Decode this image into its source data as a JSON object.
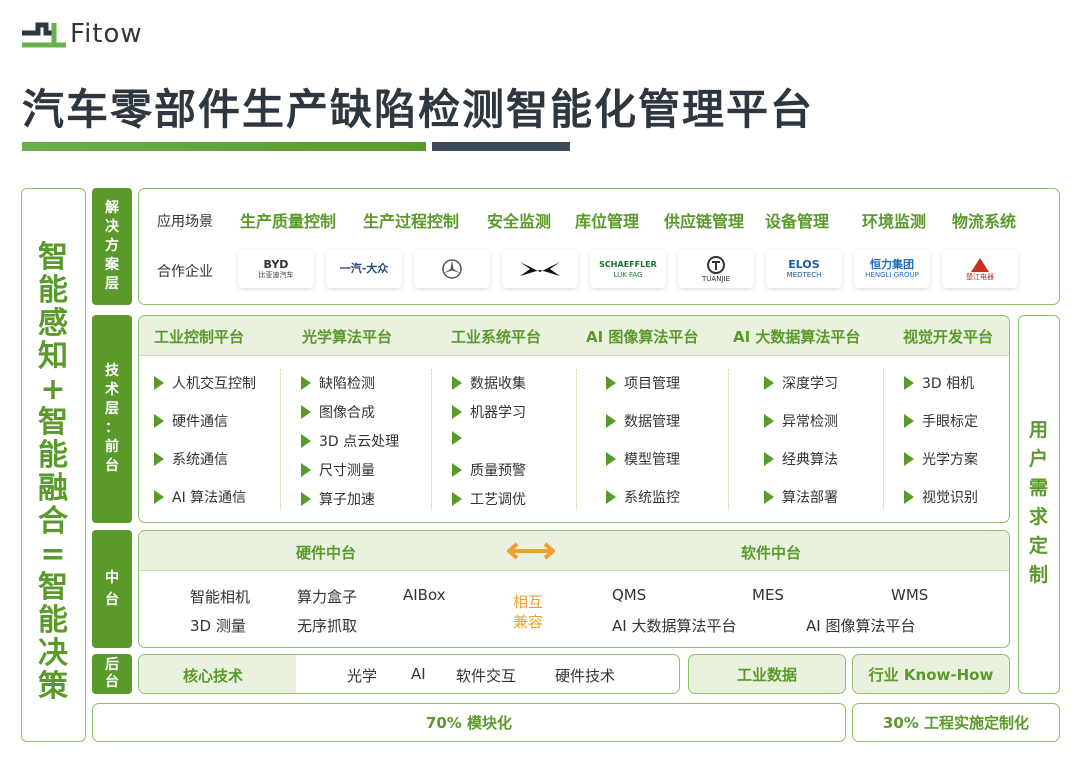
{
  "brand": {
    "logo_text": "Fitow"
  },
  "page_title": "汽车零部件生产缺陷检测智能化管理平台",
  "left_column": {
    "chars": [
      "智",
      "能",
      "感",
      "知",
      "+",
      "智",
      "能",
      "融",
      "合",
      "=",
      "智",
      "能",
      "决",
      "策"
    ]
  },
  "right_column": {
    "chars": [
      "用",
      "户",
      "需",
      "求",
      "定",
      "制"
    ]
  },
  "layers": {
    "solution": [
      "解",
      "决",
      "方",
      "案",
      "层"
    ],
    "tech_front": [
      "技",
      "术",
      "层",
      "：",
      "前",
      "台"
    ],
    "middle": [
      "中",
      "台"
    ],
    "back": [
      "后",
      "台"
    ]
  },
  "solution": {
    "scenarios_label": "应用场景",
    "scenarios": [
      "生产质量控制",
      "生产过程控制",
      "安全监测",
      "库位管理",
      "供应链管理",
      "设备管理",
      "环境监测",
      "物流系统"
    ],
    "partners_label": "合作企业",
    "partners": [
      {
        "name": "BYD",
        "sub": "比亚迪汽车"
      },
      {
        "name": "一汽-大众",
        "sub": ""
      },
      {
        "name": "",
        "sub": ""
      },
      {
        "name": "",
        "sub": ""
      },
      {
        "name": "SCHAEFFLER",
        "sub": "LUK  FAG"
      },
      {
        "name": "",
        "sub": "TUANJIE"
      },
      {
        "name": "ELOS",
        "sub": "MEDTECH"
      },
      {
        "name": "恒力集团",
        "sub": "HENGLI GROUP"
      },
      {
        "name": "",
        "sub": "楚江电器"
      }
    ]
  },
  "frontend": {
    "platforms": [
      {
        "title": "工业控制平台",
        "items": [
          "人机交互控制",
          "硬件通信",
          "系统通信",
          "AI 算法通信"
        ]
      },
      {
        "title": "光学算法平台",
        "items": [
          "缺陷检测",
          "图像合成",
          "3D 点云处理",
          "尺寸测量",
          "算子加速"
        ]
      },
      {
        "title": "工业系统平台",
        "items": [
          "数据收集",
          "机器学习",
          "",
          "质量预警",
          "工艺调优"
        ]
      },
      {
        "title": "AI 图像算法平台",
        "items": [
          "项目管理",
          "数据管理",
          "模型管理",
          "系统监控"
        ]
      },
      {
        "title": "AI 大数据算法平台",
        "items": [
          "深度学习",
          "异常检测",
          "经典算法",
          "算法部署"
        ]
      },
      {
        "title": "视觉开发平台",
        "items": [
          "3D 相机",
          "手眼标定",
          "光学方案",
          "视觉识别"
        ]
      }
    ]
  },
  "middle": {
    "hardware_title": "硬件中台",
    "software_title": "软件中台",
    "hardware_items": [
      "智能相机",
      "算力盒子",
      "AIBox",
      "3D 测量",
      "无序抓取"
    ],
    "compat": [
      "相互",
      "兼容"
    ],
    "software_items": [
      "QMS",
      "MES",
      "WMS",
      "AI 大数据算法平台",
      "AI 图像算法平台"
    ]
  },
  "back": {
    "core_label": "核心技术",
    "core_items": [
      "光学",
      "AI",
      "软件交互",
      "硬件技术"
    ],
    "industrial_data": "工业数据",
    "knowhow": "行业 Know-How"
  },
  "footer": {
    "modular": "70% 模块化",
    "custom": "30% 工程实施定制化"
  },
  "colors": {
    "accent": "#5a9a2a",
    "accent_light": "#eaf2df",
    "title_bar_dark": "#3d4a57",
    "compat_orange": "#f0a030"
  }
}
